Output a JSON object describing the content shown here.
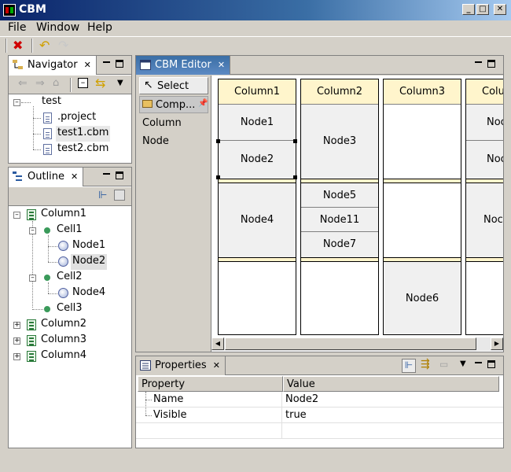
{
  "window": {
    "title": "CBM"
  },
  "menu": {
    "file": "File",
    "window": "Window",
    "help": "Help"
  },
  "navigator": {
    "tab_label": "Navigator",
    "tree": {
      "root": "test",
      "items": [
        ".project",
        "test1.cbm",
        "test2.cbm"
      ]
    }
  },
  "outline": {
    "tab_label": "Outline",
    "tree": {
      "column1": "Column1",
      "cell1": "Cell1",
      "node1": "Node1",
      "node2": "Node2",
      "cell2": "Cell2",
      "node4": "Node4",
      "cell3": "Cell3",
      "column2": "Column2",
      "column3": "Column3",
      "column4": "Column4"
    }
  },
  "editor": {
    "tab_label": "CBM Editor",
    "palette": {
      "select": "Select",
      "components": "Comp...",
      "column": "Column",
      "node": "Node"
    },
    "columns": [
      {
        "header": "Column1",
        "nodes": [
          "Node1",
          "Node2",
          "Node4"
        ]
      },
      {
        "header": "Column2",
        "nodes": [
          "Node3",
          "Node5",
          "Node11",
          "Node7"
        ]
      },
      {
        "header": "Column3",
        "nodes": [
          "Node6"
        ]
      },
      {
        "header": "Colu",
        "nodes": [
          "Noc",
          "Noc",
          "Noc"
        ]
      }
    ]
  },
  "properties": {
    "tab_label": "Properties",
    "headers": {
      "property": "Property",
      "value": "Value"
    },
    "rows": [
      {
        "name": "Name",
        "value": "Node2"
      },
      {
        "name": "Visible",
        "value": "true"
      }
    ]
  },
  "colors": {
    "title_bar": "#0a246a",
    "header_fill": "#fff5cc",
    "node_fill": "#f0f0f0",
    "selection": "#3a6ea5"
  }
}
